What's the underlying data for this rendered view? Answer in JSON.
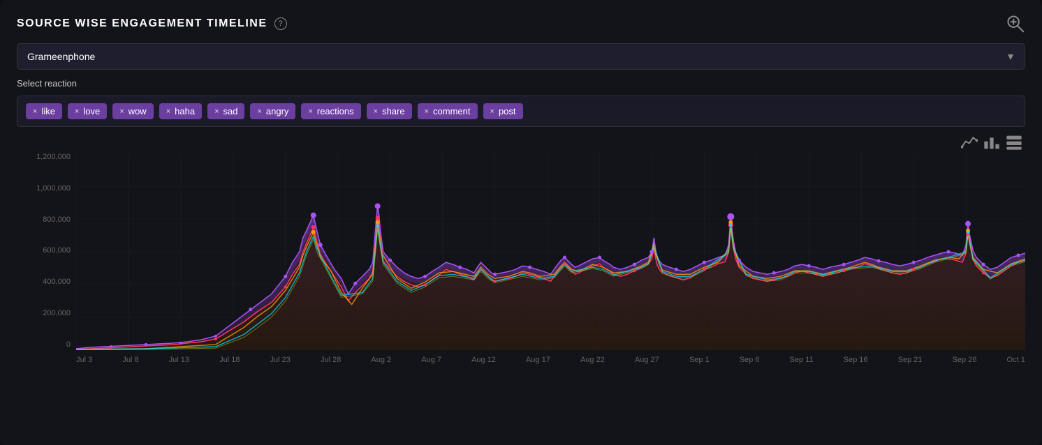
{
  "header": {
    "title": "SOURCE WISE ENGAGEMENT TIMELINE",
    "help_icon": "?",
    "zoom_icon": "⊕"
  },
  "dropdown": {
    "selected": "Grameenphone",
    "options": [
      "Grameenphone"
    ]
  },
  "reaction_label": "Select reaction",
  "tags": [
    {
      "label": "like"
    },
    {
      "label": "love"
    },
    {
      "label": "wow"
    },
    {
      "label": "haha"
    },
    {
      "label": "sad"
    },
    {
      "label": "angry"
    },
    {
      "label": "reactions"
    },
    {
      "label": "share"
    },
    {
      "label": "comment"
    },
    {
      "label": "post"
    }
  ],
  "y_axis_labels": [
    "1,200,000",
    "1,000,000",
    "800,000",
    "600,000",
    "400,000",
    "200,000",
    "0"
  ],
  "x_axis_labels": [
    "Jul 3",
    "Jul 8",
    "Jul 13",
    "Jul 18",
    "Jul 23",
    "Jul 28",
    "Aug 2",
    "Aug 7",
    "Aug 12",
    "Aug 17",
    "Aug 22",
    "Aug 27",
    "Sep 1",
    "Sep 6",
    "Sep 11",
    "Sep 16",
    "Sep 21",
    "Sep 26",
    "Oct 1"
  ],
  "chart_controls": [
    "line-icon",
    "bar-icon",
    "stack-icon"
  ]
}
